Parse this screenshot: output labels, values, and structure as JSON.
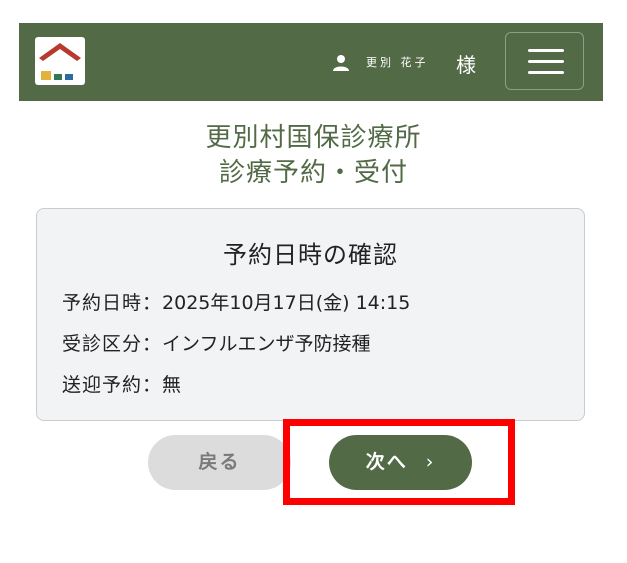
{
  "header": {
    "user_name": "更別 花子",
    "honorific": "様",
    "logo_icon": "house-logo-icon",
    "user_icon": "person-icon",
    "menu_icon": "hamburger-menu-icon"
  },
  "title": {
    "line1": "更別村国保診療所",
    "line2": "診療予約・受付"
  },
  "card": {
    "heading": "予約日時の確認",
    "rows": [
      {
        "label": "予約日時：",
        "value": "2025年10月17日(金) 14:15"
      },
      {
        "label": "受診区分：",
        "value": "インフルエンザ予防接種"
      },
      {
        "label": "送迎予約：",
        "value": "無"
      }
    ]
  },
  "buttons": {
    "back_label": "戻る",
    "next_label": "次へ",
    "next_chevron": "›"
  },
  "colors": {
    "brand_green": "#536a47",
    "highlight_red": "#ff0000",
    "back_button_bg": "#dcdcdc"
  }
}
